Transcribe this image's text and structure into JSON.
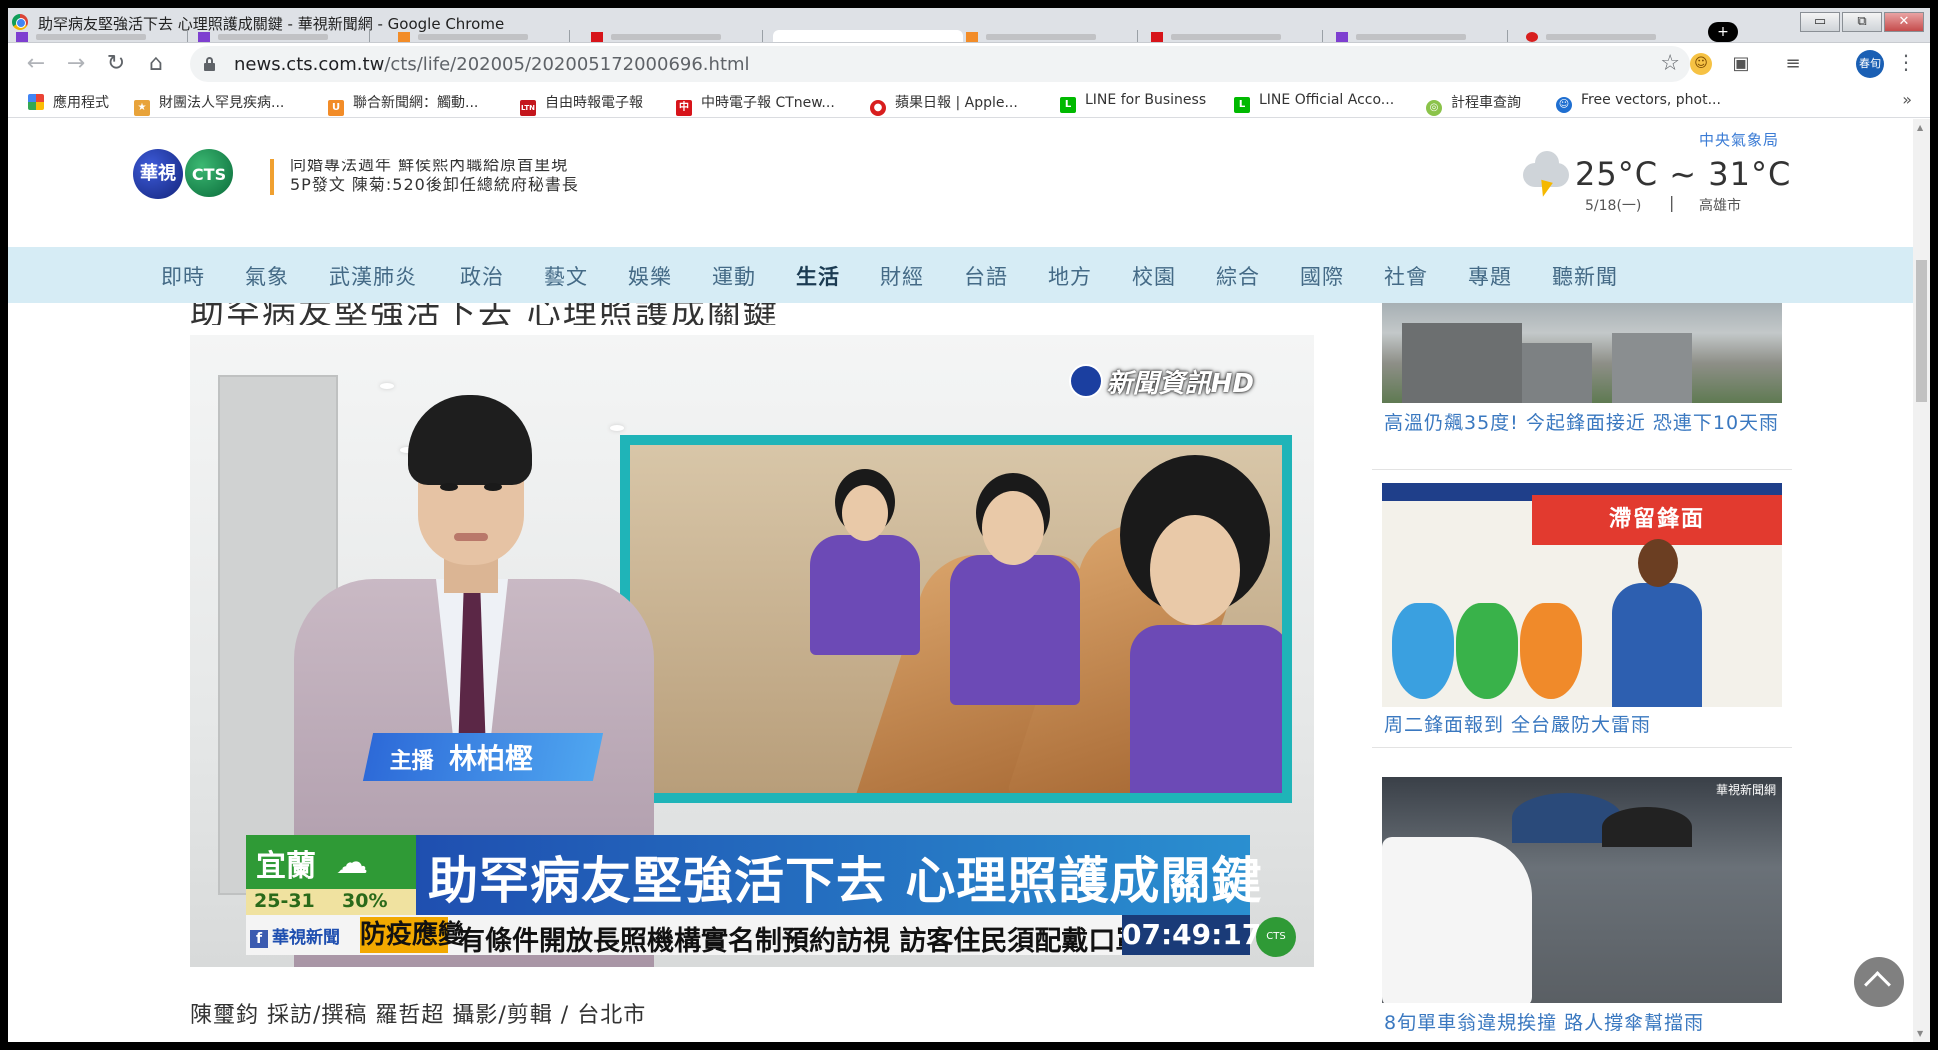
{
  "window": {
    "title": "助罕病友堅強活下去 心理照護成關鍵 - 華視新聞網 - Google Chrome",
    "controls": {
      "minimize": "▭",
      "restore": "⧉",
      "close": "✕"
    }
  },
  "toolbar": {
    "url_main": "news.cts.com.tw",
    "url_path": "/cts/life/202005/202005172000696.html",
    "profile_label": "春旬",
    "icons": [
      "back-icon",
      "forward-icon",
      "reload-icon",
      "home-icon",
      "lock-icon",
      "star-icon",
      "menu-icon"
    ]
  },
  "bookmarks": [
    {
      "label": "應用程式",
      "color": "#4285f4",
      "glyph": "⋮⋮"
    },
    {
      "label": "財團法人罕見疾病...",
      "color": "#e8a33a",
      "glyph": "★"
    },
    {
      "label": "聯合新聞網：觸動...",
      "color": "#f28c28",
      "glyph": "U"
    },
    {
      "label": "自由時報電子報",
      "color": "#c4161c",
      "glyph": "LTN"
    },
    {
      "label": "中時電子報 CTnew...",
      "color": "#d7141a",
      "glyph": "中"
    },
    {
      "label": "蘋果日報 | Apple...",
      "color": "#d81e1e",
      "glyph": "●"
    },
    {
      "label": "LINE for Business",
      "color": "#00b900",
      "glyph": "L"
    },
    {
      "label": "LINE Official Acco...",
      "color": "#00b900",
      "glyph": "L"
    },
    {
      "label": "計程車查詢",
      "color": "#8bc34a",
      "glyph": "◎"
    },
    {
      "label": "Free vectors, phot...",
      "color": "#1f6fd1",
      "glyph": "☺"
    }
  ],
  "bookmarks_more": "»",
  "header": {
    "logo_hua": "華視",
    "logo_cts": "CTS",
    "ticker": [
      "同婚專法週年 鮮侯熙內職給原首里現",
      "5P發文 陳菊:520後卸任總統府秘書長"
    ],
    "weather": {
      "source": "中央氣象局",
      "temp": "25°C ~ 31°C",
      "date": "5/18(一)",
      "separator": "|",
      "city": "高雄市"
    }
  },
  "nav": {
    "items": [
      "即時",
      "氣象",
      "武漢肺炎",
      "政治",
      "藝文",
      "娛樂",
      "運動",
      "生活",
      "財經",
      "台語",
      "地方",
      "校園",
      "綜合",
      "國際",
      "社會",
      "專題",
      "聽新聞"
    ],
    "active": "生活"
  },
  "article": {
    "title": "助罕病友堅強活下去 心理照護成關鍵",
    "video": {
      "bug": "新聞資訊HD",
      "role": "主播",
      "anchor": "林柏樫",
      "lt_city": "宜蘭",
      "lt_temp": "25-31",
      "lt_rain": "30%",
      "lt_headline": "助罕病友堅強活下去 心理照護成關鍵",
      "lt_fb": "華視新聞",
      "lt_tag": "防疫應變",
      "lt_ticker": "有條件開放長照機構實名制預約訪視 訪客住民須配戴口罩",
      "lt_clock": "07:49:17"
    },
    "byline": "陳璽鈞 採訪/撰稿 羅哲超 攝影/剪輯  / 台北市"
  },
  "sidebar": {
    "items": [
      {
        "caption": "高溫仍飆35度! 今起鋒面接近 恐連下10天雨"
      },
      {
        "caption": "周二鋒面報到 全台嚴防大雷雨",
        "thumb_title": "滯留鋒面"
      },
      {
        "caption": "8旬單車翁違規挨撞 路人撐傘幫擋雨",
        "thumb_tag": "華視新聞網"
      }
    ]
  }
}
